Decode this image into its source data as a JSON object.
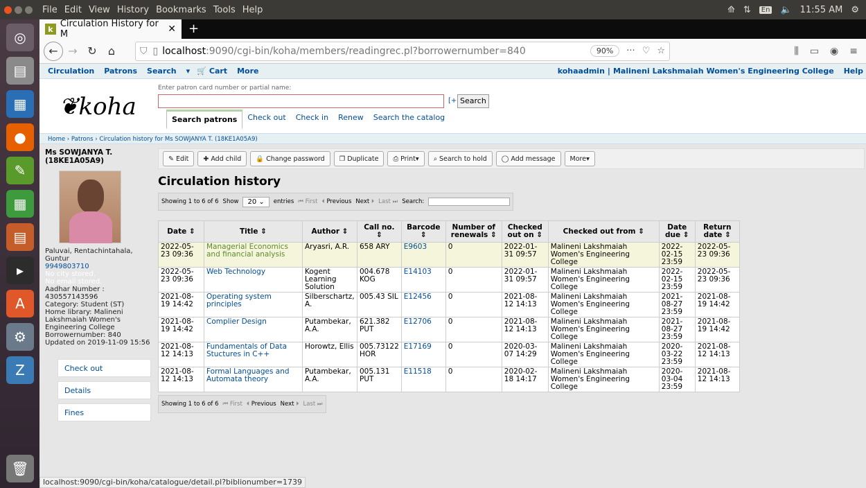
{
  "os": {
    "menus": [
      "File",
      "Edit",
      "View",
      "History",
      "Bookmarks",
      "Tools",
      "Help"
    ],
    "time": "11:55 AM",
    "kb": "En"
  },
  "browser": {
    "tab_title": "Circulation History for M",
    "url_host": "localhost",
    "url_rest": ":9090/cgi-bin/koha/members/readingrec.pl?borrowernumber=840",
    "zoom": "90%",
    "status_url": "localhost:9090/cgi-bin/koha/catalogue/detail.pl?biblionumber=1739"
  },
  "koha_nav": {
    "circulation": "Circulation",
    "patrons": "Patrons",
    "search": "Search",
    "cart": "Cart",
    "more": "More",
    "user": "kohaadmin",
    "library": "Malineni Lakshmaiah Women's Engineering College",
    "help": "Help"
  },
  "header": {
    "logo": "koha",
    "hint": "Enter patron card number or partial name:",
    "plus": "[+]",
    "search_btn": "Search",
    "tabs": [
      "Search patrons",
      "Check out",
      "Check in",
      "Renew",
      "Search the catalog"
    ]
  },
  "breadcrumb": {
    "home": "Home",
    "patrons": "Patrons",
    "current": "Circulation history for Ms SOWJANYA T. (18KE1A05A9)"
  },
  "patron": {
    "name": "Ms SOWJANYA T.",
    "card": "(18KE1A05A9)",
    "address": "Paluvai, Rentachintahala,",
    "city": "Guntur",
    "phone": "9949803710",
    "no_city": "No city stored.",
    "no_email": "No email stored.",
    "aadhar_label": "Aadhar Number :",
    "aadhar": "430557143596",
    "category": "Category: Student (ST)",
    "home_library": "Home library: Malineni Lakshmaiah Women's Engineering College",
    "borrowernumber": "Borrowernumber: 840",
    "updated": "Updated on 2019-11-09 15:56"
  },
  "sidenav": [
    "Check out",
    "Details",
    "Fines"
  ],
  "toolbar": {
    "edit": "Edit",
    "add_child": "Add child",
    "change_password": "Change password",
    "duplicate": "Duplicate",
    "print": "Print",
    "search_hold": "Search to hold",
    "add_message": "Add message",
    "more": "More"
  },
  "page_title": "Circulation history",
  "datatable": {
    "showing": "Showing 1 to 6 of 6",
    "show": "Show",
    "entries_value": "20",
    "entries": "entries",
    "first": "First",
    "previous": "Previous",
    "next": "Next",
    "last": "Last",
    "search": "Search:"
  },
  "table": {
    "headers": [
      "Date",
      "Title",
      "Author",
      "Call no.",
      "Barcode",
      "Number of renewals",
      "Checked out on",
      "Checked out from",
      "Date due",
      "Return date"
    ],
    "rows": [
      [
        "2022-05-23 09:36",
        "Managerial Economics and financial analysis",
        "Aryasri, A.R.",
        "658 ARY",
        "E9603",
        "0",
        "2022-01-31 09:57",
        "Malineni Lakshmaiah Women's Engineering College",
        "2022-02-15 23:59",
        "2022-05-23 09:36"
      ],
      [
        "2022-05-23 09:36",
        "Web Technology",
        "Kogent Learning Solution",
        "004.678 KOG",
        "E14103",
        "0",
        "2022-01-31 09:57",
        "Malineni Lakshmaiah Women's Engineering College",
        "2022-02-15 23:59",
        "2022-05-23 09:36"
      ],
      [
        "2021-08-19 14:42",
        "Operating system principles",
        "Silberschartz, A.",
        "005.43 SIL",
        "E12456",
        "0",
        "2021-08-12 14:13",
        "Malineni Lakshmaiah Women's Engineering College",
        "2021-08-27 23:59",
        "2021-08-19 14:42"
      ],
      [
        "2021-08-19 14:42",
        "Complier Design",
        "Putambekar, A.A.",
        "621.382 PUT",
        "E12706",
        "0",
        "2021-08-12 14:13",
        "Malineni Lakshmaiah Women's Engineering College",
        "2021-08-27 23:59",
        "2021-08-19 14:42"
      ],
      [
        "2021-08-12 14:13",
        "Fundamentals of Data Stuctures in C++",
        "Horowtz, Ellis",
        "005.73122 HOR",
        "E17169",
        "0",
        "2020-03-07 14:29",
        "Malineni Lakshmaiah Women's Engineering College",
        "2020-03-22 23:59",
        "2021-08-12 14:13"
      ],
      [
        "2021-08-12 14:13",
        "Formal Languages and Automata theory",
        "Putambekar, A.A.",
        "005.131 PUT",
        "E11518",
        "0",
        "2020-02-18 14:17",
        "Malineni Lakshmaiah Women's Engineering College",
        "2020-03-04 23:59",
        "2021-08-12 14:13"
      ]
    ]
  }
}
